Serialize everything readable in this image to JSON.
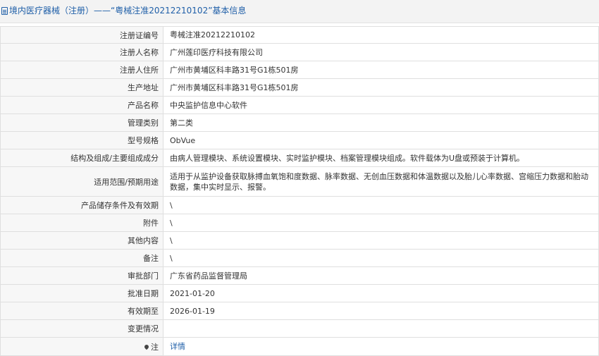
{
  "header": {
    "title": "境内医疗器械（注册）——“粤械注准20212210102”基本信息"
  },
  "rows": [
    {
      "label": "注册证编号",
      "value": "粤械注准20212210102"
    },
    {
      "label": "注册人名称",
      "value": "广州莲印医疗科技有限公司"
    },
    {
      "label": "注册人住所",
      "value": "广州市黄埔区科丰路31号G1栋501房"
    },
    {
      "label": "生产地址",
      "value": "广州市黄埔区科丰路31号G1栋501房"
    },
    {
      "label": "产品名称",
      "value": "中央监护信息中心软件"
    },
    {
      "label": "管理类别",
      "value": "第二类"
    },
    {
      "label": "型号规格",
      "value": "ObVue"
    },
    {
      "label": "结构及组成/主要组成成分",
      "value": "由病人管理模块、系统设置模块、实时监护模块、档案管理模块组成。软件载体为U盘或预装于计算机。"
    },
    {
      "label": "适用范围/预期用途",
      "value": "适用于从监护设备获取脉搏血氧饱和度数据、脉率数据、无创血压数据和体温数据以及胎儿心率数据、宫缩压力数据和胎动数据，集中实时显示、报警。"
    },
    {
      "label": "产品储存条件及有效期",
      "value": "\\"
    },
    {
      "label": "附件",
      "value": "\\"
    },
    {
      "label": "其他内容",
      "value": "\\"
    },
    {
      "label": "备注",
      "value": "\\"
    },
    {
      "label": "审批部门",
      "value": "广东省药品监督管理局"
    },
    {
      "label": "批准日期",
      "value": "2021-01-20"
    },
    {
      "label": "有效期至",
      "value": "2026-01-19"
    },
    {
      "label": "变更情况",
      "value": ""
    }
  ],
  "footer_row": {
    "label": "注",
    "icon": "location-pin-icon",
    "link_text": "详情",
    "link_color": "#1f5fa8"
  }
}
